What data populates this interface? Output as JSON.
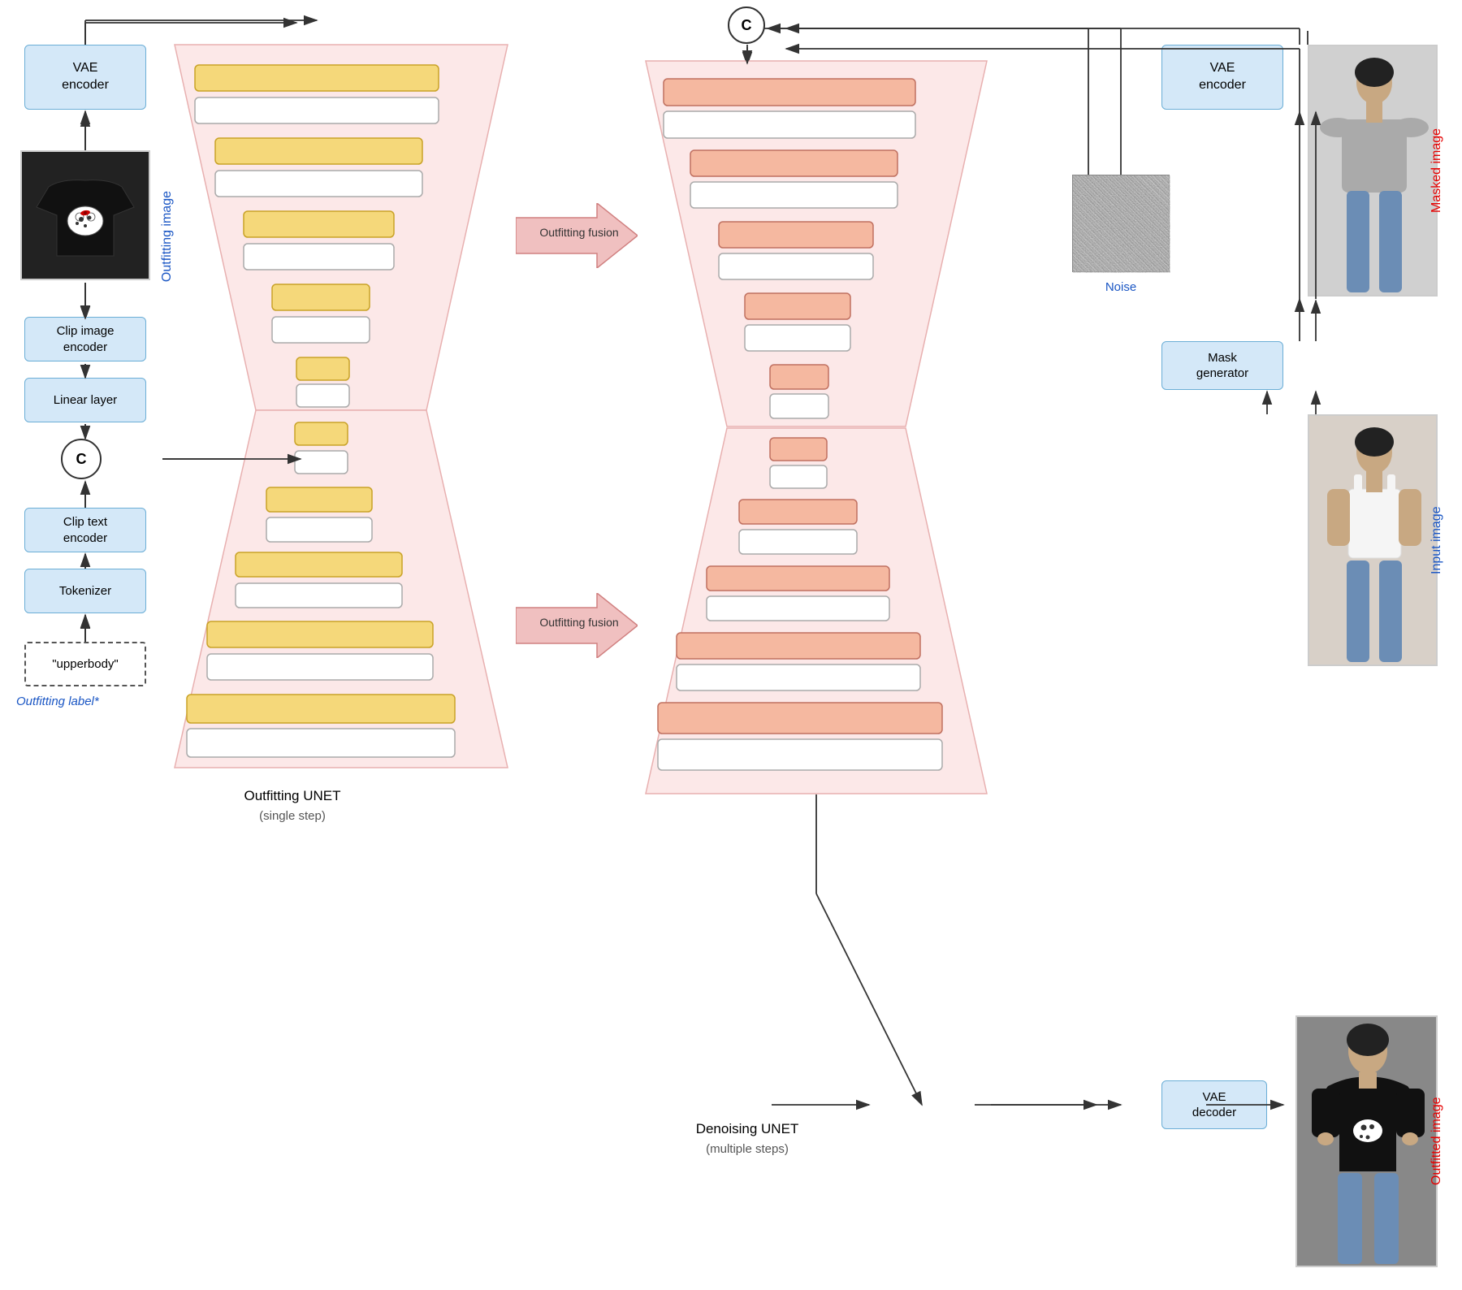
{
  "left_column": {
    "vae_encoder_left": "VAE\nencoder",
    "clip_image_encoder": "Clip image\nencoder",
    "linear_layer": "Linear layer",
    "concat_symbol": "C",
    "clip_text_encoder": "Clip text\nencoder",
    "tokenizer": "Tokenizer",
    "outfitting_label_box": "\"upperbody\"",
    "outfitting_label_text": "Outfitting label*"
  },
  "center": {
    "outfitting_image_label": "Outfitting image",
    "outfitting_fusion_top": "Outfitting fusion",
    "outfitting_fusion_bottom": "Outfitting fusion",
    "outfitting_unet_label": "Outfitting UNET",
    "outfitting_unet_sub": "(single step)",
    "denoising_unet_label": "Denoising UNET",
    "denoising_unet_sub": "(multiple steps)"
  },
  "right_column": {
    "vae_encoder_right": "VAE\nencoder",
    "concat_symbol": "C",
    "noise_label": "Noise",
    "masked_image_label": "Masked image",
    "mask_generator": "Mask\ngenerator",
    "input_image_label": "Input image",
    "vae_decoder": "VAE\ndecoder",
    "outfitted_image_label": "Outfitted image"
  },
  "colors": {
    "blue_box": "#d4e8f8",
    "blue_border": "#6baed6",
    "pink_bg": "#fce8e8",
    "yellow_layer": "#f5d87a",
    "accent_blue": "#1a56c4",
    "accent_red": "#e60000"
  }
}
